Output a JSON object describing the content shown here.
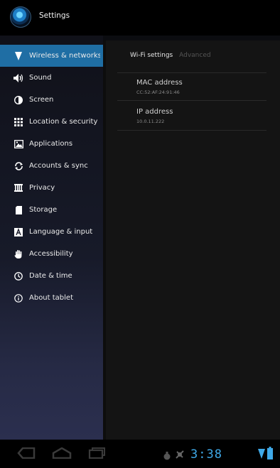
{
  "app": {
    "title": "Settings"
  },
  "sidebar": {
    "items": [
      {
        "label": "Wireless & networks",
        "icon": "wifi-icon",
        "active": true
      },
      {
        "label": "Sound",
        "icon": "speaker-icon"
      },
      {
        "label": "Screen",
        "icon": "brightness-icon"
      },
      {
        "label": "Location & security",
        "icon": "keypad-icon"
      },
      {
        "label": "Applications",
        "icon": "applications-icon"
      },
      {
        "label": "Accounts & sync",
        "icon": "sync-icon"
      },
      {
        "label": "Privacy",
        "icon": "privacy-icon"
      },
      {
        "label": "Storage",
        "icon": "storage-icon"
      },
      {
        "label": "Language & input",
        "icon": "language-icon"
      },
      {
        "label": "Accessibility",
        "icon": "hand-icon"
      },
      {
        "label": "Date & time",
        "icon": "clock-icon"
      },
      {
        "label": "About tablet",
        "icon": "info-icon"
      }
    ]
  },
  "content": {
    "tabs": {
      "active": "Wi-Fi settings",
      "inactive": "Advanced"
    },
    "mac": {
      "title": "MAC address",
      "value": "CC:52:AF:24:91:46"
    },
    "ip": {
      "title": "IP address",
      "value": "10.0.11.222"
    }
  },
  "statusbar": {
    "time": "3:38"
  },
  "colors": {
    "accent": "#1f6ea4",
    "clock": "#3fa9e8"
  }
}
